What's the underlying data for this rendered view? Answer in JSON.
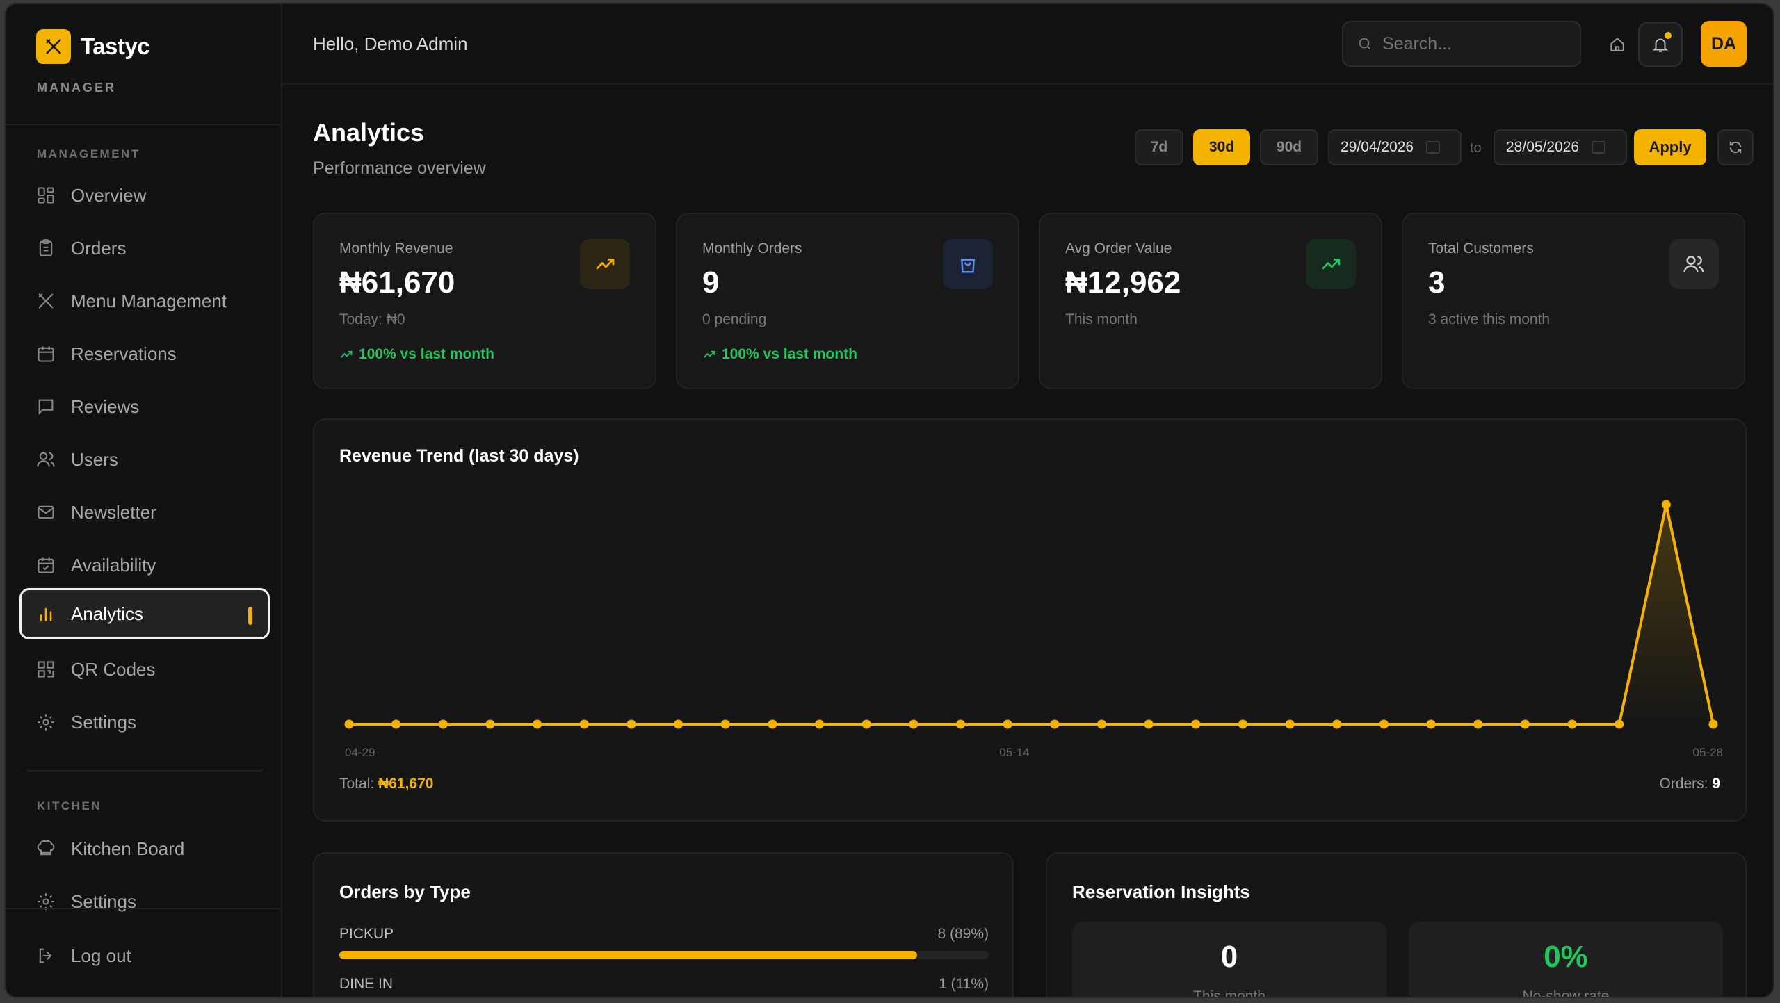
{
  "brand": {
    "name": "Tastyc",
    "role": "MANAGER"
  },
  "sidebar": {
    "management_label": "MANAGEMENT",
    "items": [
      {
        "label": "Overview",
        "icon": "grid-icon"
      },
      {
        "label": "Orders",
        "icon": "clipboard-icon"
      },
      {
        "label": "Menu Management",
        "icon": "utensils-icon"
      },
      {
        "label": "Reservations",
        "icon": "calendar-icon"
      },
      {
        "label": "Reviews",
        "icon": "message-icon"
      },
      {
        "label": "Users",
        "icon": "users-icon"
      },
      {
        "label": "Newsletter",
        "icon": "mail-icon"
      },
      {
        "label": "Availability",
        "icon": "calendar-check-icon"
      },
      {
        "label": "Analytics",
        "icon": "bar-chart-icon",
        "active": true
      },
      {
        "label": "QR Codes",
        "icon": "qr-icon"
      },
      {
        "label": "Settings",
        "icon": "gear-icon"
      }
    ],
    "kitchen_label": "KITCHEN",
    "kitchen_items": [
      {
        "label": "Kitchen Board",
        "icon": "chef-hat-icon"
      },
      {
        "label": "Settings",
        "icon": "gear-icon"
      }
    ],
    "logout": "Log out"
  },
  "header": {
    "greeting": "Hello, Demo Admin",
    "search_placeholder": "Search...",
    "avatar": "DA"
  },
  "page": {
    "title": "Analytics",
    "subtitle": "Performance overview",
    "ranges": [
      "7d",
      "30d",
      "90d"
    ],
    "active_range": "30d",
    "date_from": "29/04/2026",
    "date_to_label": "to",
    "date_to": "28/05/2026",
    "apply": "Apply"
  },
  "stats": [
    {
      "label": "Monthly Revenue",
      "value": "₦61,670",
      "note": "Today: ₦0",
      "trend": "100% vs last month",
      "icon": "trending-up-icon"
    },
    {
      "label": "Monthly Orders",
      "value": "9",
      "note": "0 pending",
      "trend": "100% vs last month",
      "icon": "shopping-bag-icon"
    },
    {
      "label": "Avg Order Value",
      "value": "₦12,962",
      "note": "This month",
      "trend": "",
      "icon": "trending-up-icon"
    },
    {
      "label": "Total Customers",
      "value": "3",
      "note": "3 active this month",
      "trend": "",
      "icon": "users-icon"
    }
  ],
  "revenue_chart": {
    "title": "Revenue Trend (last 30 days)",
    "x_ticks": [
      "04-29",
      "05-14",
      "05-28"
    ],
    "total_label": "Total:",
    "total_value": "₦61,670",
    "orders_label": "Orders:",
    "orders_value": "9"
  },
  "chart_data": {
    "type": "area",
    "title": "Revenue Trend (last 30 days)",
    "x": [
      "04-29",
      "04-30",
      "05-01",
      "05-02",
      "05-03",
      "05-04",
      "05-05",
      "05-06",
      "05-07",
      "05-08",
      "05-09",
      "05-10",
      "05-11",
      "05-12",
      "05-13",
      "05-14",
      "05-15",
      "05-16",
      "05-17",
      "05-18",
      "05-19",
      "05-20",
      "05-21",
      "05-22",
      "05-23",
      "05-24",
      "05-25",
      "05-26",
      "05-27",
      "05-28"
    ],
    "values": [
      0,
      0,
      0,
      0,
      0,
      0,
      0,
      0,
      0,
      0,
      0,
      0,
      0,
      0,
      0,
      0,
      0,
      0,
      0,
      0,
      0,
      0,
      0,
      0,
      0,
      0,
      0,
      0,
      61670,
      0
    ],
    "xticks_shown": [
      "04-29",
      "05-14",
      "05-28"
    ],
    "color": "#f5b301",
    "grid": false
  },
  "orders_by_type": {
    "title": "Orders by Type",
    "rows": [
      {
        "label": "PICKUP",
        "count": "8 (89%)",
        "fraction": 0.89
      },
      {
        "label": "DINE IN",
        "count": "1 (11%)",
        "fraction": 0.11
      }
    ]
  },
  "reservation_insights": {
    "title": "Reservation Insights",
    "cards": [
      {
        "value": "0",
        "label": "This month",
        "color": "#ffffff"
      },
      {
        "value": "0%",
        "label": "No-show rate",
        "color": "#22c55e"
      }
    ]
  },
  "colors": {
    "accent": "#f5b301",
    "positive": "#22c55e",
    "background": "#111111"
  }
}
